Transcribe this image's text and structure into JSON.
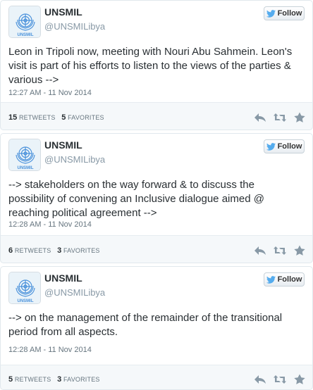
{
  "tweets": [
    {
      "name": "UNSMIL",
      "handle": "@UNSMILibya",
      "follow_label": "Follow",
      "text": "Leon in Tripoli now, meeting with Nouri Abu Sahmein. Leon's visit is part of his efforts to listen to the views of the parties & various -->",
      "timestamp": "12:27 AM - 11 Nov 2014",
      "retweets": "15",
      "retweets_label": "RETWEETS",
      "favorites": "5",
      "favorites_label": "FAVORITES"
    },
    {
      "name": "UNSMIL",
      "handle": "@UNSMILibya",
      "follow_label": "Follow",
      "text": "--> stakeholders on the way forward & to discuss the possibility of convening an Inclusive dialogue aimed @ reaching political agreement -->",
      "timestamp": "12:28 AM - 11 Nov 2014",
      "retweets": "6",
      "retweets_label": "RETWEETS",
      "favorites": "3",
      "favorites_label": "FAVORITES"
    },
    {
      "name": "UNSMIL",
      "handle": "@UNSMILibya",
      "follow_label": "Follow",
      "text": "--> on the management of the remainder of the transitional period from all aspects.",
      "timestamp": "12:28 AM - 11 Nov 2014",
      "retweets": "5",
      "retweets_label": "RETWEETS",
      "favorites": "3",
      "favorites_label": "FAVORITES"
    }
  ],
  "icons": {
    "avatar": "un-emblem-icon",
    "follow": "twitter-bird-icon",
    "reply": "reply-icon",
    "retweet": "retweet-icon",
    "favorite": "star-icon"
  },
  "colors": {
    "name_text": "#292f33",
    "handle_text": "#8899a6",
    "bird_blue": "#55acee",
    "un_blue": "#4b92db",
    "action_gray": "#8899a6",
    "footer_bg": "#f5f8fa"
  }
}
